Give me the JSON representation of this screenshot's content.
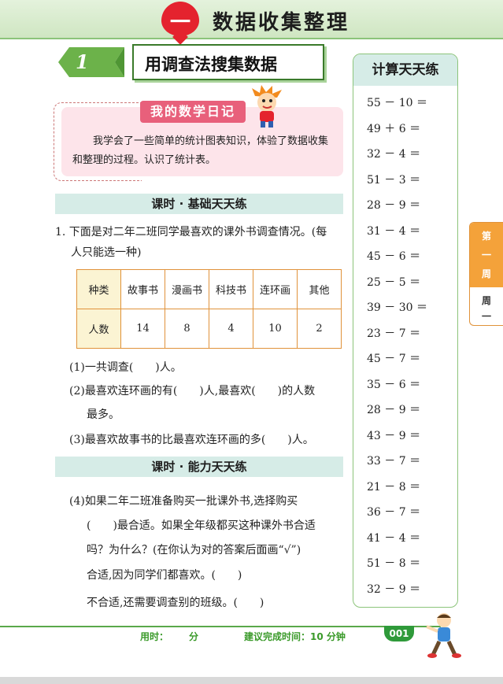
{
  "header": {
    "chapter_number": "一",
    "chapter_title": "数据收集整理"
  },
  "lesson": {
    "number": "1",
    "title": "用调查法搜集数据"
  },
  "diary": {
    "label": "我的数学日记",
    "text": "我学会了一些简单的统计图表知识，体验了数据收集和整理的过程。认识了统计表。"
  },
  "sections": {
    "basic": "课时 · 基础天天练",
    "ability": "课时 · 能力天天练"
  },
  "question1": {
    "intro_line1": "1. 下面是对二年二班同学最喜欢的课外书调查情况。(每",
    "intro_line2": "人只能选一种)",
    "table": {
      "row1_header": "种类",
      "categories": [
        "故事书",
        "漫画书",
        "科技书",
        "连环画",
        "其他"
      ],
      "row2_header": "人数",
      "counts": [
        "14",
        "8",
        "4",
        "10",
        "2"
      ]
    },
    "sub1": "(1)一共调查(　　)人。",
    "sub2_line1": "(2)最喜欢连环画的有(　　)人,最喜欢(　　)的人数",
    "sub2_line2": "最多。",
    "sub3": "(3)最喜欢故事书的比最喜欢连环画的多(　　)人。",
    "sub4_line1": "(4)如果二年二班准备购买一批课外书,选择购买",
    "sub4_line2": "(　　)最合适。如果全年级都买这种课外书合适",
    "sub4_line3": "吗？为什么？(在你认为对的答案后面画“√”)",
    "sub4_line4": "合适,因为同学们都喜欢。(　　)",
    "sub4_line5": "不合适,还需要调查别的班级。(　　)"
  },
  "mental_math": {
    "title": "计算天天练",
    "items": [
      "55 － 10 ＝",
      "49 ＋ 6 ＝",
      "32 － 4 ＝",
      "51 － 3 ＝",
      "28 － 9 ＝",
      "31 － 4 ＝",
      "45 － 6 ＝",
      "25 － 5 ＝",
      "39 － 30 ＝",
      "23 － 7 ＝",
      "45 － 7 ＝",
      "35 － 6 ＝",
      "28 － 9 ＝",
      "43 － 9 ＝",
      "33 － 7 ＝",
      "21 － 8 ＝",
      "36 － 7 ＝",
      "41 － 4 ＝",
      "51 － 8 ＝",
      "32 － 9 ＝"
    ]
  },
  "week_tab": {
    "chars_top": [
      "第",
      "一",
      "周"
    ],
    "chars_bottom": [
      "周",
      "一"
    ]
  },
  "footer": {
    "time_used": "用时：",
    "minute": "分",
    "suggested": "建议完成时间：10 分钟",
    "page": "001"
  },
  "colors": {
    "accent_red": "#e4232e",
    "green": "#3a9a2a",
    "orange": "#f4a23a",
    "pink": "#e8607b"
  }
}
